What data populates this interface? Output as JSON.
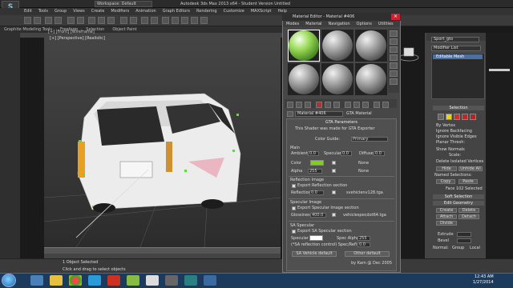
{
  "window": {
    "title": "Autodesk 3ds Max 2013 x64 - Student Version   Untitled",
    "workspace": "Workspace: Default",
    "menus": [
      "Edit",
      "Tools",
      "Group",
      "Views",
      "Create",
      "Modifiers",
      "Animation",
      "Graph Editors",
      "Rendering",
      "Customize",
      "MAXScript",
      "Help"
    ]
  },
  "ribbon": {
    "tabs": [
      "Graphite Modeling Tools",
      "Freeform",
      "Selection",
      "Object Paint"
    ]
  },
  "viewport": {
    "label": "[+] [Perspective] [Realistic]",
    "label_top": "[+] [Front] [Wireframe]"
  },
  "status": {
    "objects": "1 Object Selected",
    "hint": "Click and drag to select objects"
  },
  "taskbar": {
    "time": "12:43 AM",
    "date": "1/27/2014"
  },
  "command_panel": {
    "object_name": "Sport_gto",
    "modifier_list": "Modifier List",
    "stack_item": "Editable Mesh",
    "selection_header": "Selection",
    "by_vertex": "By Vertex",
    "ignore_backfacing": "Ignore Backfacing",
    "ignore_visible_edges": "Ignore Visible Edges",
    "planar_thresh": "Planar Thresh:",
    "show_normals": "Show Normals",
    "scale": "Scale:",
    "delete_isolated": "Delete Isolated Vertices",
    "hide": "Hide",
    "unhide_all": "Unhide All",
    "named_selections": "Named Selections:",
    "copy": "Copy",
    "paste": "Paste",
    "selected_status": "Face 102 Selected",
    "soft_selection": "Soft Selection",
    "edit_geometry": "Edit Geometry",
    "create": "Create",
    "delete": "Delete",
    "attach": "Attach",
    "detach": "Detach",
    "divide": "Divide",
    "extrude": "Extrude",
    "bevel": "Bevel",
    "normal_label": "Normal:",
    "group": "Group",
    "local": "Local"
  },
  "material_editor": {
    "title": "Material Editor - Material #406",
    "menus": [
      "Modes",
      "Material",
      "Navigation",
      "Options",
      "Utilities"
    ],
    "material_name": "Material #406",
    "material_type": "GTA Material",
    "params_header": "GTA Parameters",
    "params_note": "This Shader was made for GTA Exporter",
    "color_guide_label": "Color Guide:",
    "color_guide_value": "Primary",
    "main_label": "Main",
    "ambient_label": "Ambient",
    "specular_label": "Specular",
    "diffuse_label": "Diffuse",
    "ambient": "0.0",
    "specular": "0.0",
    "diffuse": "0.0",
    "color_label": "Color",
    "none_1": "None",
    "alpha_label": "Alpha",
    "alpha": "255",
    "none_2": "None",
    "reflection_header": "Reflection Image",
    "export_reflection": "Export Reflection section",
    "reflection_label": "Reflection",
    "reflection_value": "0.0",
    "reflection_map": "svehiclenv128.tga",
    "specular_img_header": "Specular Image",
    "export_specular": "Export Specular Image section",
    "glossiness_label": "Glossiness",
    "glossiness_value": "400.0",
    "specular_map": "vehiclespecdot64.tga",
    "sa_specular_header": "SA Specular",
    "export_sa": "Export SA Specular section",
    "spec_alpha_label": "Spec Alpha",
    "spec_alpha": "255",
    "sa_specular_label": "Specular",
    "sa_reflection_note": "(*SA reflection control) Spec/Refl Blend",
    "sa_blend": "0.0",
    "sa_vehicle_default": "SA Vehicle default",
    "other_default": "Other default",
    "footer": "by Kam @ Dec 2005"
  },
  "colors": {
    "accent_green": "#7dd30f",
    "selection_blue": "#4a6fa0",
    "taskbar": "#1b3a5c"
  }
}
